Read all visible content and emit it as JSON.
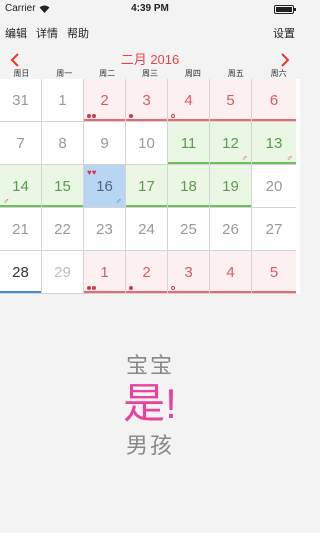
{
  "status": {
    "carrier": "Carrier",
    "time": "4:39 PM"
  },
  "nav": {
    "edit": "编辑",
    "details": "详情",
    "help": "帮助",
    "settings": "设置"
  },
  "calendar": {
    "title": "二月 2016",
    "prev": "‹",
    "next": "›",
    "weekdays": [
      "周日",
      "周一",
      "周二",
      "周三",
      "周四",
      "周五",
      "周六"
    ],
    "rows": [
      [
        "31",
        "1",
        "2",
        "3",
        "4",
        "5",
        "6"
      ],
      [
        "7",
        "8",
        "9",
        "10",
        "11",
        "12",
        "13"
      ],
      [
        "14",
        "15",
        "16",
        "17",
        "18",
        "19",
        "20"
      ],
      [
        "21",
        "22",
        "23",
        "24",
        "25",
        "26",
        "27"
      ],
      [
        "28",
        "29",
        "1",
        "2",
        "3",
        "4",
        "5"
      ]
    ]
  },
  "marks": {
    "male": "♂",
    "hearts": "♥♥"
  },
  "result": {
    "line1": "宝宝",
    "line2": "是!",
    "line3": "男孩"
  },
  "colors": {
    "accent": "#e8404b",
    "pink": "#e8419e",
    "green": "#6cbf5c",
    "blue": "#3d8ed9"
  }
}
